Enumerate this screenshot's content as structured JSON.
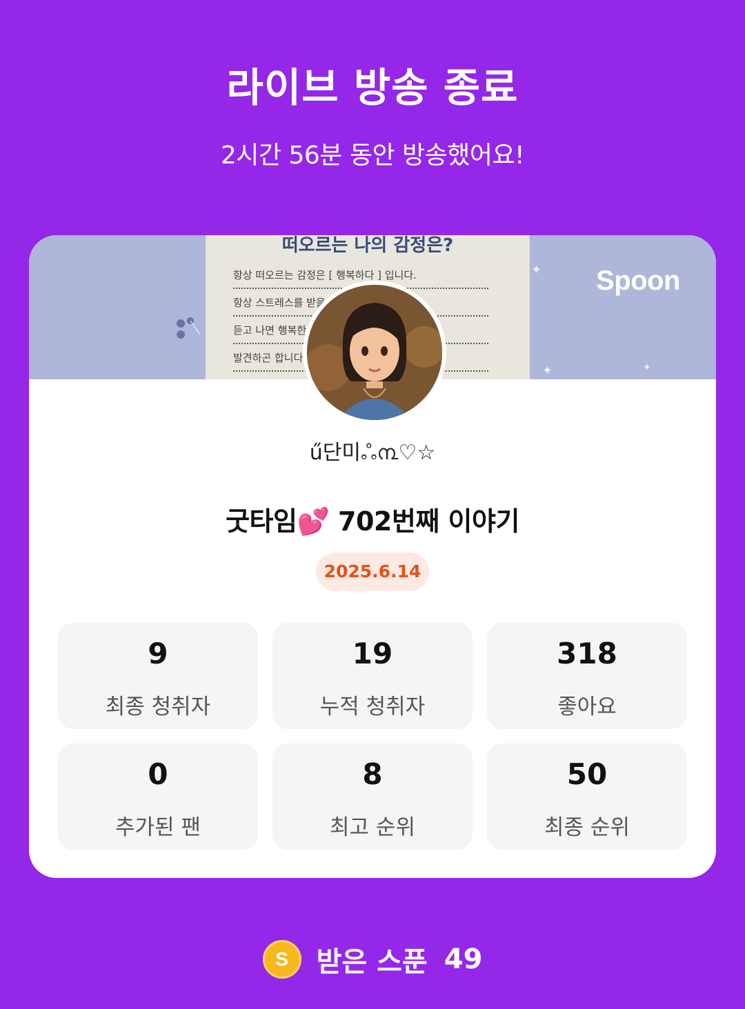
{
  "header": {
    "title": "라이브 방송 종료",
    "subtitle": "2시간 56분 동안 방송했어요!"
  },
  "card": {
    "banner": {
      "brand": "Spoon",
      "paper_title": "떠오르는 나의 감정은?",
      "paper_lines": [
        "항상 떠오르는 감정은 [ 행복하다 ] 입니다.",
        "항상 스트레스를 받을 때 단미의 방송을",
        "듣고 나면 행복한 내 모습을",
        "발견하곤 합니다. 스트레스는"
      ]
    },
    "username": "ű단미ஃ൩♡☆",
    "broadcast_title": "굿타임",
    "broadcast_title_emoji": "💕",
    "broadcast_title_suffix": "702번째 이야기",
    "date": "2025.6.14",
    "stats": [
      {
        "value": "9",
        "label": "최종 청취자"
      },
      {
        "value": "19",
        "label": "누적 청취자"
      },
      {
        "value": "318",
        "label": "좋아요"
      },
      {
        "value": "0",
        "label": "추가된 팬"
      },
      {
        "value": "8",
        "label": "최고 순위"
      },
      {
        "value": "50",
        "label": "최종 순위"
      }
    ]
  },
  "footer": {
    "coin_icon": "spoon-coin-icon",
    "coin_letter": "S",
    "label": "받은 스푼",
    "count": "49"
  },
  "colors": {
    "background": "#9427E8",
    "banner": "#AEB6DA",
    "date_badge_bg": "#FDE9E3",
    "date_badge_text": "#E0531C",
    "stat_bg": "#F5F5F5",
    "coin": "#F6B81E"
  }
}
